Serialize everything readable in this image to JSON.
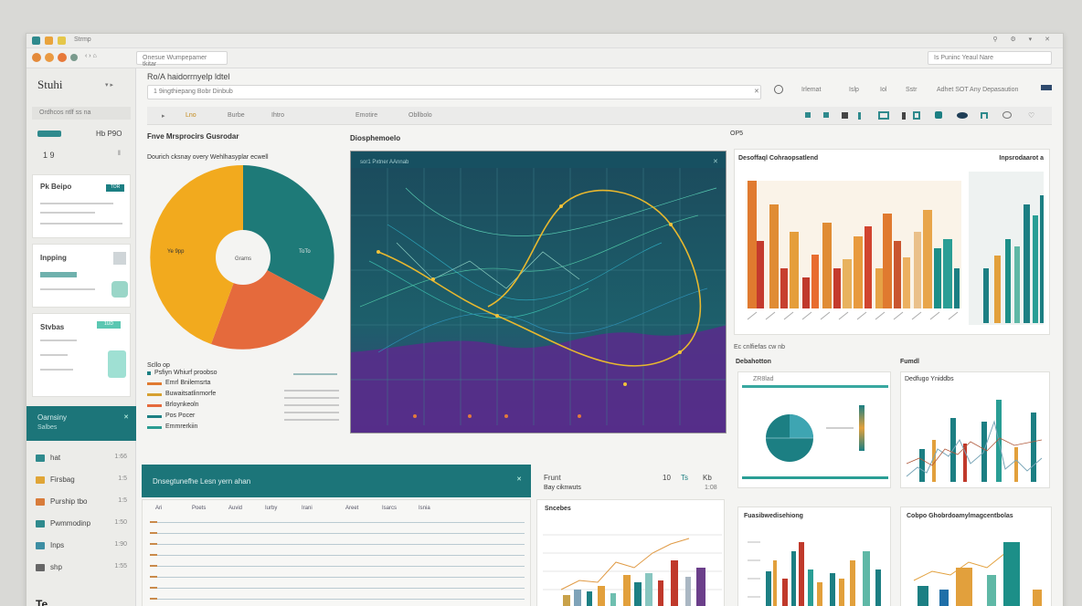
{
  "window": {
    "title": "Stuhi",
    "tab_label": "Strmp",
    "address": "Onesue  Wumpepamer  tkitar",
    "right_address": "Is  Puninc  Yeaul  Nare",
    "search_placeholder": "1  9ingthiepang  Bobr  Dinbub",
    "section_title": "Ro/A  haidorrnyelp  ldtel"
  },
  "sidebar": {
    "brand": "Stuhi",
    "filter_label": "Ordhcos  ntlf  ss  na",
    "tag_label": "Hb  P9O",
    "counter": "1  9",
    "cards": [
      {
        "title": "Pk  Beipo",
        "badge": "TOR"
      },
      {
        "title": "Inpping",
        "badge": ""
      },
      {
        "title": "Stvbas",
        "badge": "1UD"
      }
    ],
    "active_item": {
      "label": "Oarnsiny",
      "sub": "Salbes"
    },
    "items": [
      {
        "label": "hat",
        "count": "1:66"
      },
      {
        "label": "Firsbag",
        "count": "1:5"
      },
      {
        "label": "Purship  tbo",
        "count": "1:5"
      },
      {
        "label": "Pwmmodinp",
        "count": "1:50"
      },
      {
        "label": "Inps",
        "count": "1:90"
      },
      {
        "label": "shp",
        "count": "1:55"
      }
    ],
    "footer": "Te"
  },
  "topnav": {
    "tabs": [
      "Lno",
      "Burbe",
      "Ihtro",
      "Emotire",
      "Obllbolo"
    ],
    "right_links": [
      "Irlemat",
      "Islp",
      "Iol",
      "Sstr",
      "Adhet  SOT  Any  Depasaution"
    ]
  },
  "donut": {
    "panel_title": "Fnve  Mrsprocirs  Gusrodar",
    "subtitle": "Dourich  cksnay  overy  Wehlhasyplar  ecwell",
    "center_label": "Grams",
    "left_label": "Ye  9pp",
    "right_label": "ToTo",
    "colors": {
      "yellow": "#f2aa1e",
      "teal": "#1e7a78",
      "orange": "#e56a3c"
    },
    "legend_title": "Scllo  op",
    "legend": [
      "Psfiyn  Whiurf  proobso",
      "Emrl  Bnilemsrta",
      "Buwaitsatlinmorfe",
      "Brloynkeoln",
      "Pos  Pocer",
      "Emmrerkiin"
    ]
  },
  "main_chart": {
    "panel_title": "Diosphemoelo",
    "inner_title": "sor1  Pxtner  AAnnab"
  },
  "bar_panel": {
    "top_label": "OP5",
    "title": "Desoffaql  Cohraopsatlend",
    "right_title": "Inpsrodaarot  a"
  },
  "mini_panels": {
    "caption": "Ec  cnlfiefas  cw  nb",
    "left_title": "Debahotton",
    "left_sub": "ZR8lad",
    "right_title": "Fumdl",
    "right_sub": "Dedfugo  Yniddbs"
  },
  "table": {
    "header": "Dnsegtunefhe  Lesn  yern  ahan",
    "columns": [
      "Ari",
      "Poets",
      "Auvid",
      "Iurby",
      "Irani",
      "Areet",
      "Isarcs",
      "Isnia"
    ]
  },
  "bottom_panels": {
    "stat_title": "Frunt",
    "stat_sub": "Bay  ciknwuts",
    "stat_values": [
      "10",
      "Ts",
      "Kb"
    ],
    "stat_small": "1:08",
    "bars_title": "Sncebes",
    "mid_title": "Fuasibwedisehiong",
    "right_title": "Cobpo  Ghobrdoamylmagcentbolas"
  }
}
